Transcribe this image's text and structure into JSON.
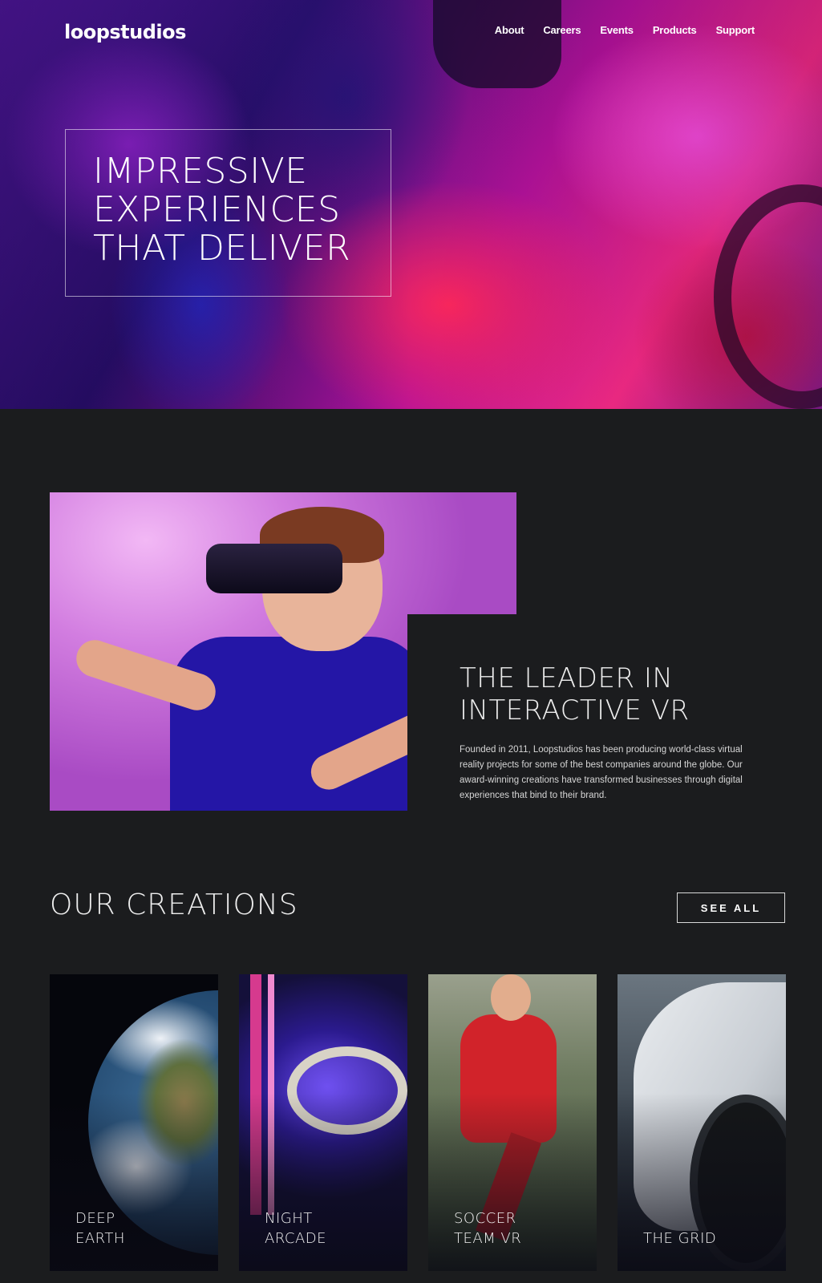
{
  "header": {
    "logo": "loopstudios",
    "nav": [
      "About",
      "Careers",
      "Events",
      "Products",
      "Support"
    ]
  },
  "hero": {
    "title": "IMPRESSIVE\nEXPERIENCES\nTHAT DELIVER"
  },
  "leader": {
    "title": "THE LEADER IN\nINTERACTIVE VR",
    "text": "Founded in 2011, Loopstudios has been producing world-class virtual reality projects for some of the best companies around the globe. Our award-winning creations have transformed businesses through digital experiences that bind to their brand."
  },
  "creations": {
    "title": "OUR CREATIONS",
    "see_all": "SEE ALL",
    "cards": [
      {
        "label": "DEEP\nEARTH",
        "image_icon": "earth-image"
      },
      {
        "label": "NIGHT\nARCADE",
        "image_icon": "arcade-image"
      },
      {
        "label": "SOCCER\nTEAM VR",
        "image_icon": "soccer-image"
      },
      {
        "label": "THE GRID",
        "image_icon": "race-car-image"
      }
    ]
  },
  "colors": {
    "background": "#1b1c1e",
    "text": "#ffffff",
    "hero_accent": "#ff2c8a"
  }
}
